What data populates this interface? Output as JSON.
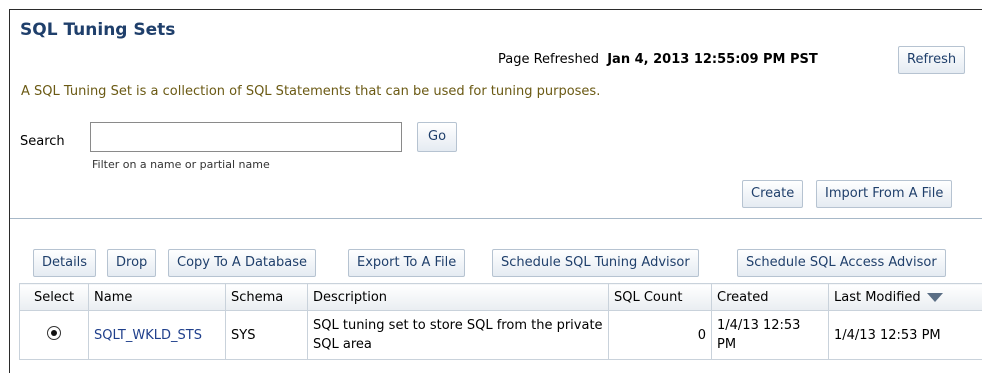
{
  "page": {
    "title": "SQL Tuning Sets",
    "refreshed_label": "Page Refreshed",
    "refreshed_time": "Jan 4, 2013 12:55:09 PM PST",
    "refresh_button": "Refresh",
    "description": "A SQL Tuning Set is a collection of SQL Statements that can be used for tuning purposes."
  },
  "search": {
    "label": "Search",
    "value": "",
    "go_button": "Go",
    "hint": "Filter on a name or partial name"
  },
  "top_actions": {
    "create": "Create",
    "import": "Import From A File"
  },
  "toolbar": {
    "details": "Details",
    "drop": "Drop",
    "copy": "Copy To A Database",
    "export": "Export To A File",
    "schedule_tuning": "Schedule SQL Tuning Advisor",
    "schedule_access": "Schedule SQL Access Advisor"
  },
  "table": {
    "headers": [
      "Select",
      "Name",
      "Schema",
      "Description",
      "SQL Count",
      "Created",
      "Last Modified"
    ],
    "rows": [
      {
        "selected": true,
        "name": "SQLT_WKLD_STS",
        "schema": "SYS",
        "description": "SQL tuning set to store SQL from the private SQL area",
        "sql_count": "0",
        "created": "1/4/13 12:53 PM",
        "last_modified": "1/4/13 12:53 PM"
      }
    ]
  }
}
